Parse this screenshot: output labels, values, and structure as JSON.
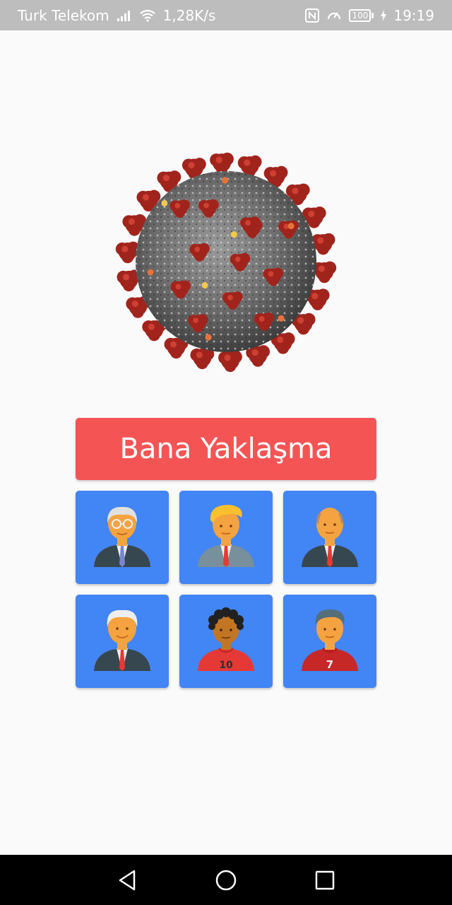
{
  "status_bar": {
    "carrier": "Turk Telekom",
    "speed": "1,28K/s",
    "battery": "100",
    "time": "19:19",
    "icons": [
      "signal-icon",
      "wifi-icon",
      "nfc-icon",
      "data-saver-icon",
      "battery-icon",
      "charging-icon"
    ]
  },
  "main": {
    "image": "coronavirus-illustration",
    "button_label": "Bana Yaklaşma"
  },
  "avatars": [
    {
      "name": "elderly-man-glasses-avatar"
    },
    {
      "name": "blond-man-avatar"
    },
    {
      "name": "bald-man-avatar"
    },
    {
      "name": "grey-haired-man-avatar"
    },
    {
      "name": "curly-hair-player-avatar"
    },
    {
      "name": "football-player-7-avatar"
    }
  ],
  "nav_bar": {
    "icons": [
      "back-icon",
      "home-icon",
      "recents-icon"
    ]
  },
  "colors": {
    "button": "#f55455",
    "tile": "#4285f4",
    "status_bar": "#bdbdbd",
    "nav_bar": "#000000"
  }
}
